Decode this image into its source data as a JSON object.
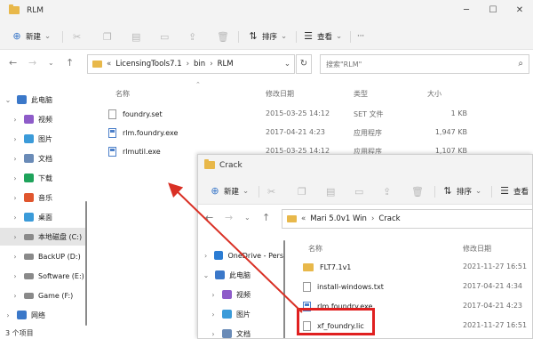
{
  "win1": {
    "title": "RLM",
    "toolbar": {
      "new_label": "新建",
      "sort_label": "排序",
      "view_label": "查看",
      "more": "···"
    },
    "breadcrumb": [
      "LicensingTools7.1",
      "bin",
      "RLM"
    ],
    "search_placeholder": "搜索\"RLM\"",
    "columns": {
      "name": "名称",
      "modified": "修改日期",
      "type": "类型",
      "size": "大小"
    },
    "files": [
      {
        "name": "foundry.set",
        "modified": "2015-03-25 14:12",
        "type": "SET 文件",
        "size": "1 KB",
        "icon": "file"
      },
      {
        "name": "rlm.foundry.exe",
        "modified": "2017-04-21 4:23",
        "type": "应用程序",
        "size": "1,947 KB",
        "icon": "exe"
      },
      {
        "name": "rlmutil.exe",
        "modified": "2015-03-25 14:12",
        "type": "应用程序",
        "size": "1,107 KB",
        "icon": "exe"
      }
    ],
    "sidebar": [
      {
        "label": "此电脑",
        "icon": "pc",
        "color": "#3b78c9",
        "expanded": true
      },
      {
        "label": "视频",
        "icon": "video",
        "color": "#8e5cc9"
      },
      {
        "label": "图片",
        "icon": "picture",
        "color": "#3b9bd9"
      },
      {
        "label": "文档",
        "icon": "document",
        "color": "#6a8bb7"
      },
      {
        "label": "下载",
        "icon": "download",
        "color": "#1fa35b"
      },
      {
        "label": "音乐",
        "icon": "music",
        "color": "#e0562e"
      },
      {
        "label": "桌面",
        "icon": "desktop",
        "color": "#3b9bd9"
      },
      {
        "label": "本地磁盘 (C:)",
        "icon": "drive",
        "color": "#8a8a8a",
        "selected": true
      },
      {
        "label": "BackUP (D:)",
        "icon": "drive",
        "color": "#8a8a8a"
      },
      {
        "label": "Software (E:)",
        "icon": "drive",
        "color": "#8a8a8a"
      },
      {
        "label": "Game (F:)",
        "icon": "drive",
        "color": "#8a8a8a"
      },
      {
        "label": "网络",
        "icon": "network",
        "color": "#3b78c9"
      }
    ],
    "status": "3 个项目"
  },
  "win2": {
    "title": "Crack",
    "toolbar": {
      "new_label": "新建",
      "sort_label": "排序",
      "view_label": "查看"
    },
    "breadcrumb": [
      "Mari 5.0v1 Win",
      "Crack"
    ],
    "columns": {
      "name": "名称",
      "modified": "修改日期"
    },
    "files": [
      {
        "name": "FLT7.1v1",
        "modified": "2021-11-27 16:51",
        "icon": "folder"
      },
      {
        "name": "install-windows.txt",
        "modified": "2017-04-21 4:34",
        "icon": "file"
      },
      {
        "name": "rlm.foundry.exe",
        "modified": "2017-04-21 4:23",
        "icon": "exe"
      },
      {
        "name": "xf_foundry.lic",
        "modified": "2021-11-27 16:51",
        "icon": "file"
      }
    ],
    "sidebar": [
      {
        "label": "OneDrive - Pers",
        "icon": "cloud",
        "color": "#2b7cd3"
      },
      {
        "label": "此电脑",
        "icon": "pc",
        "color": "#3b78c9",
        "expanded": true
      },
      {
        "label": "视频",
        "icon": "video",
        "color": "#8e5cc9"
      },
      {
        "label": "图片",
        "icon": "picture",
        "color": "#3b9bd9"
      },
      {
        "label": "文档",
        "icon": "document",
        "color": "#6a8bb7"
      }
    ]
  },
  "colors": {
    "highlight": "#e02020",
    "arrow": "#d93025",
    "folder": "#e8b84a"
  }
}
